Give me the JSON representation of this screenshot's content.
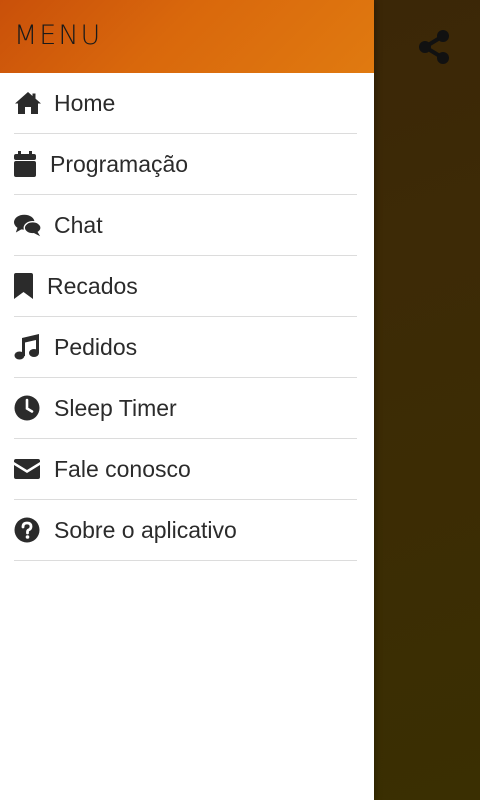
{
  "drawer": {
    "title": "MENU",
    "items": [
      {
        "label": "Home",
        "icon": "home-icon"
      },
      {
        "label": "Programação",
        "icon": "calendar-icon"
      },
      {
        "label": "Chat",
        "icon": "chat-icon"
      },
      {
        "label": "Recados",
        "icon": "bookmark-icon"
      },
      {
        "label": "Pedidos",
        "icon": "music-note-icon"
      },
      {
        "label": "Sleep Timer",
        "icon": "clock-icon"
      },
      {
        "label": "Fale conosco",
        "icon": "envelope-icon"
      },
      {
        "label": "Sobre o aplicativo",
        "icon": "question-circle-icon"
      }
    ]
  },
  "toolbar": {
    "share_icon": "share-icon"
  },
  "colors": {
    "header_start": "#c9500a",
    "header_end": "#e07a10",
    "backdrop": "#3a2a06",
    "icon": "#2b2b2b",
    "divider": "#dcdcdc"
  }
}
